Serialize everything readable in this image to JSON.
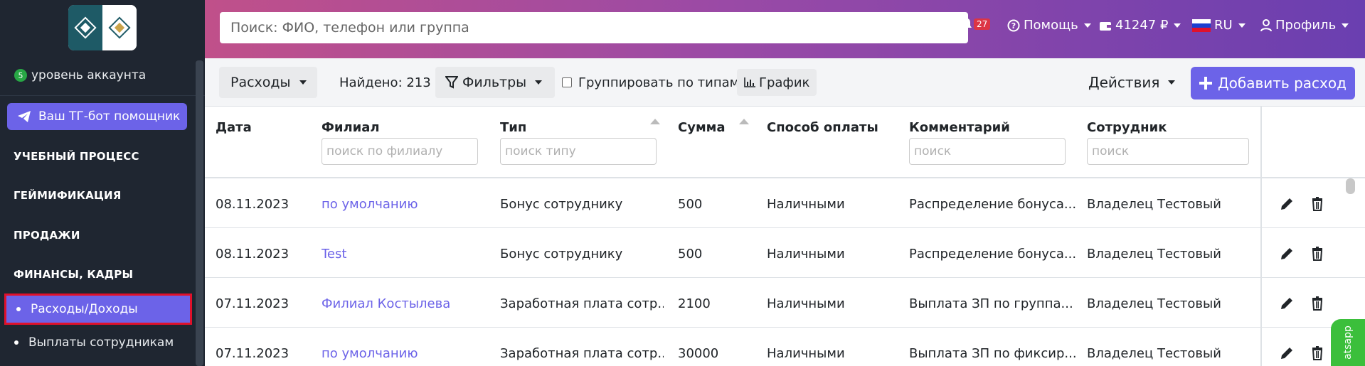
{
  "sidebar": {
    "account_level_badge": "5",
    "account_level_text": "уровень аккаунта",
    "tg_button": "Ваш ТГ-бот помощник",
    "sections": {
      "learning": "УЧЕБНЫЙ ПРОЦЕСС",
      "gamification": "ГЕЙМИФИКАЦИЯ",
      "sales": "ПРОДАЖИ",
      "finance": "ФИНАНСЫ, КАДРЫ"
    },
    "sub_items": {
      "expenses_income": "Расходы/Доходы",
      "staff_payments": "Выплаты сотрудникам"
    }
  },
  "topbar": {
    "search_placeholder": "Поиск: ФИО, телефон или группа",
    "notifications_count": "27",
    "help": "Помощь",
    "balance": "41247 ₽",
    "language": "RU",
    "profile": "Профиль"
  },
  "toolbar": {
    "mode_label": "Расходы",
    "found": "Найдено: 213",
    "filters": "Фильтры",
    "group_by_types": "Группировать по типам",
    "chart": "График",
    "actions": "Действия",
    "add_expense": "Добавить расход"
  },
  "table": {
    "headers": {
      "date": "Дата",
      "branch": "Филиал",
      "type": "Тип",
      "amount": "Сумма",
      "payment_method": "Способ оплаты",
      "comment": "Комментарий",
      "employee": "Сотрудник"
    },
    "filters": {
      "branch_placeholder": "поиск по филиалу",
      "type_placeholder": "поиск типу",
      "comment_placeholder": "поиск",
      "employee_placeholder": "поиск"
    },
    "rows": [
      {
        "date": "08.11.2023",
        "branch": "по умолчанию",
        "type": "Бонус сотруднику",
        "amount": "500",
        "method": "Наличными",
        "comment": "Распределение бонуса...",
        "employee": "Владелец Тестовый"
      },
      {
        "date": "08.11.2023",
        "branch": "Test",
        "type": "Бонус сотруднику",
        "amount": "500",
        "method": "Наличными",
        "comment": "Распределение бонуса...",
        "employee": "Владелец Тестовый"
      },
      {
        "date": "07.11.2023",
        "branch": "Филиал Костылева",
        "type": "Заработная плата сотр...",
        "amount": "2100",
        "method": "Наличными",
        "comment": "Выплата ЗП по группа...",
        "employee": "Владелец Тестовый"
      },
      {
        "date": "07.11.2023",
        "branch": "по умолчанию",
        "type": "Заработная плата сотр...",
        "amount": "30000",
        "method": "Наличными",
        "comment": "Выплата ЗП по фиксир...",
        "employee": "Владелец Тестовый"
      }
    ]
  },
  "whatsapp_label": "atsapp",
  "colors": {
    "accent": "#6c63e8",
    "sidebar_bg": "#1f2631",
    "active_outline": "#e0112b",
    "badge_red": "#dc3545"
  }
}
